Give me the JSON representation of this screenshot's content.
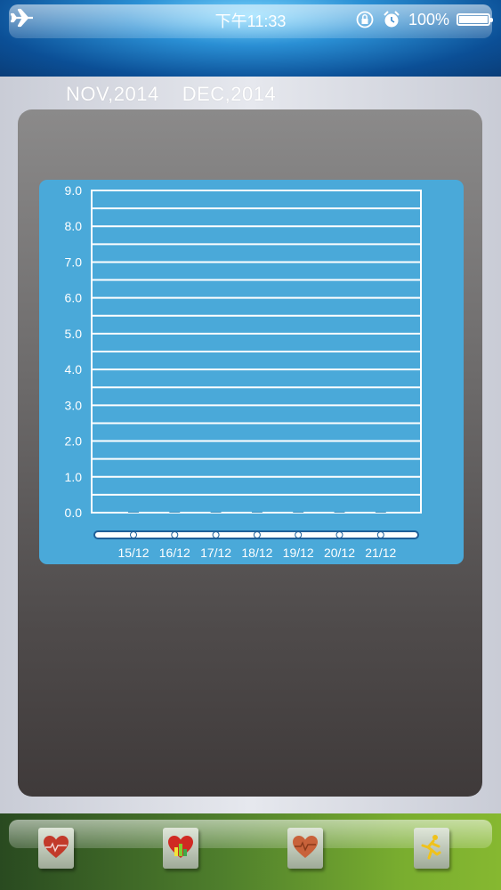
{
  "status_bar": {
    "time": "下午11:33",
    "battery_percent": "100%",
    "battery_level": 1.0,
    "icons": [
      "airplane-icon",
      "rotation-lock-icon",
      "alarm-icon",
      "battery-icon"
    ]
  },
  "month_tabs": [
    {
      "label": "NOV,2014"
    },
    {
      "label": "DEC,2014"
    }
  ],
  "chart_data": {
    "type": "bar",
    "categories": [
      "15/12",
      "16/12",
      "17/12",
      "18/12",
      "19/12",
      "20/12",
      "21/12"
    ],
    "values": [
      0,
      0,
      0,
      0,
      0,
      0,
      0
    ],
    "ylim": [
      0,
      9
    ],
    "y_ticks": [
      "0.0",
      "1.0",
      "2.0",
      "3.0",
      "4.0",
      "5.0",
      "6.0",
      "7.0",
      "8.0",
      "9.0"
    ],
    "grid": true,
    "colors": {
      "background": "#4aa9d9",
      "grid": "#ffffff",
      "text": "#ffffff"
    }
  },
  "bottom_tabs": [
    {
      "icon": "heart-icon"
    },
    {
      "icon": "heart-chart-icon"
    },
    {
      "icon": "heart-pulse-icon"
    },
    {
      "icon": "running-man-icon"
    }
  ],
  "colors": {
    "header_blue": "#2a8fd4",
    "bottom_green": "#79ad2f",
    "panel_gray": "#5a5656"
  }
}
